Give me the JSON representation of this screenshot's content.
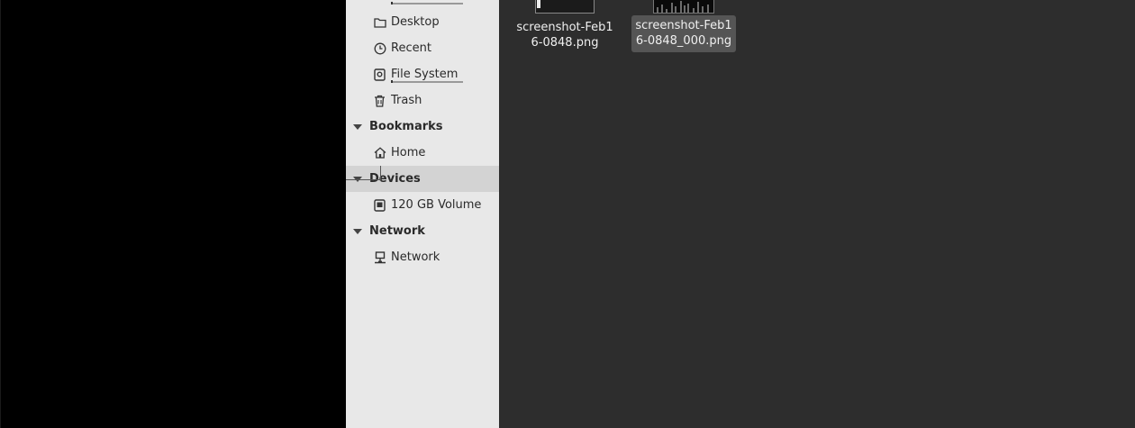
{
  "sidebar": {
    "places": [
      {
        "label": "Desktop",
        "icon": "folder-icon"
      },
      {
        "label": "Recent",
        "icon": "clock-icon"
      },
      {
        "label": "File System",
        "icon": "drive-icon"
      },
      {
        "label": "Trash",
        "icon": "trash-icon"
      }
    ],
    "sections": {
      "bookmarks": {
        "label": "Bookmarks",
        "items": [
          {
            "label": "Home",
            "icon": "home-icon"
          }
        ]
      },
      "devices": {
        "label": "Devices",
        "items": [
          {
            "label": "120 GB Volume",
            "icon": "disk-icon"
          }
        ]
      },
      "network": {
        "label": "Network",
        "items": [
          {
            "label": "Network",
            "icon": "network-icon"
          }
        ]
      }
    }
  },
  "files": [
    {
      "name": "screenshot-Feb16-0848.png",
      "selected": false
    },
    {
      "name": "screenshot-Feb16-0848_000.png",
      "selected": true
    }
  ],
  "colors": {
    "sidebar_bg": "#e8e8e8",
    "main_bg": "#2d2d2d",
    "selection_bg": "#555555",
    "section_selected_bg": "#d3d3d3"
  }
}
